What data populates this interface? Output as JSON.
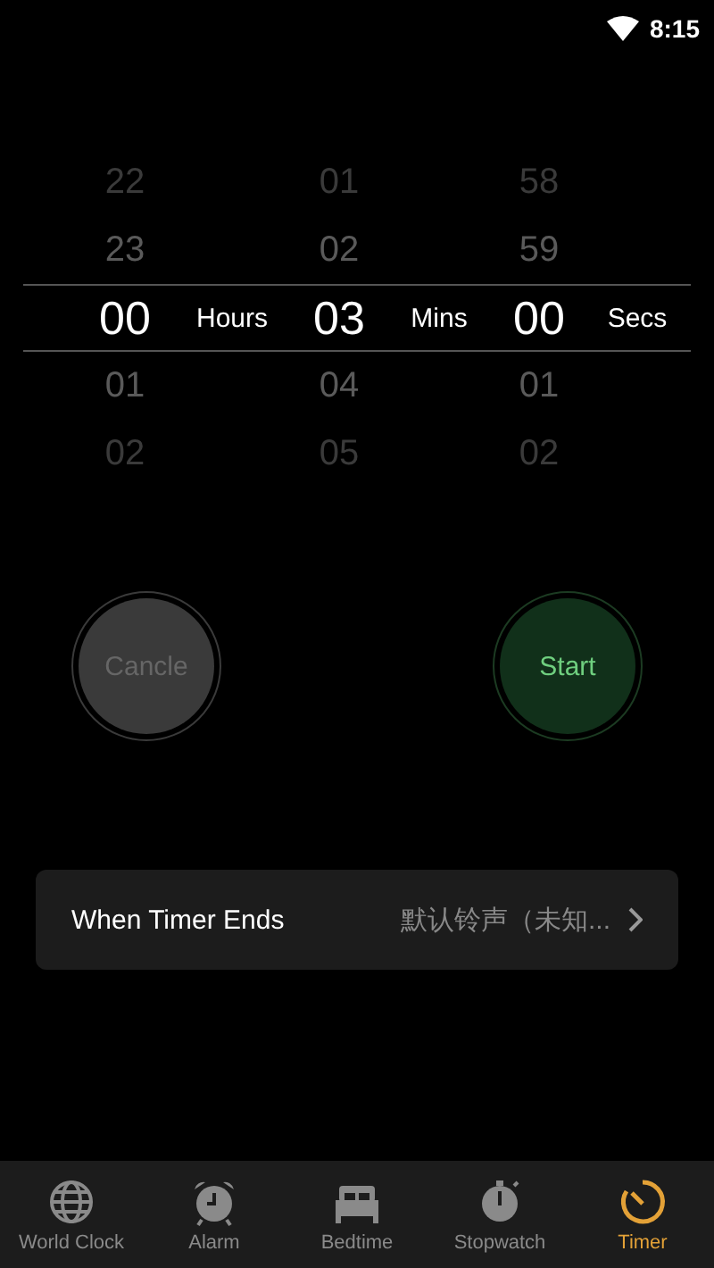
{
  "status_bar": {
    "time": "8:15"
  },
  "picker": {
    "columns": [
      {
        "unit": "Hours",
        "values": [
          {
            "text": "22",
            "selected": false
          },
          {
            "text": "23",
            "selected": false
          },
          {
            "text": "00",
            "selected": true
          },
          {
            "text": "01",
            "selected": false
          },
          {
            "text": "02",
            "selected": false
          }
        ]
      },
      {
        "unit": "Mins",
        "values": [
          {
            "text": "01",
            "selected": false
          },
          {
            "text": "02",
            "selected": false
          },
          {
            "text": "03",
            "selected": true
          },
          {
            "text": "04",
            "selected": false
          },
          {
            "text": "05",
            "selected": false
          }
        ]
      },
      {
        "unit": "Secs",
        "values": [
          {
            "text": "58",
            "selected": false
          },
          {
            "text": "59",
            "selected": false
          },
          {
            "text": "00",
            "selected": true
          },
          {
            "text": "01",
            "selected": false
          },
          {
            "text": "02",
            "selected": false
          }
        ]
      }
    ]
  },
  "buttons": [
    {
      "label": "Cancle",
      "kind": "cancel"
    },
    {
      "label": "Start",
      "kind": "start"
    }
  ],
  "setting": {
    "label": "When Timer Ends",
    "value": "默认铃声（未知..."
  },
  "tabs": [
    {
      "label": "World Clock",
      "selected": false
    },
    {
      "label": "Alarm",
      "selected": false
    },
    {
      "label": "Bedtime",
      "selected": false
    },
    {
      "label": "Stopwatch",
      "selected": false
    },
    {
      "label": "Timer",
      "selected": true
    }
  ]
}
